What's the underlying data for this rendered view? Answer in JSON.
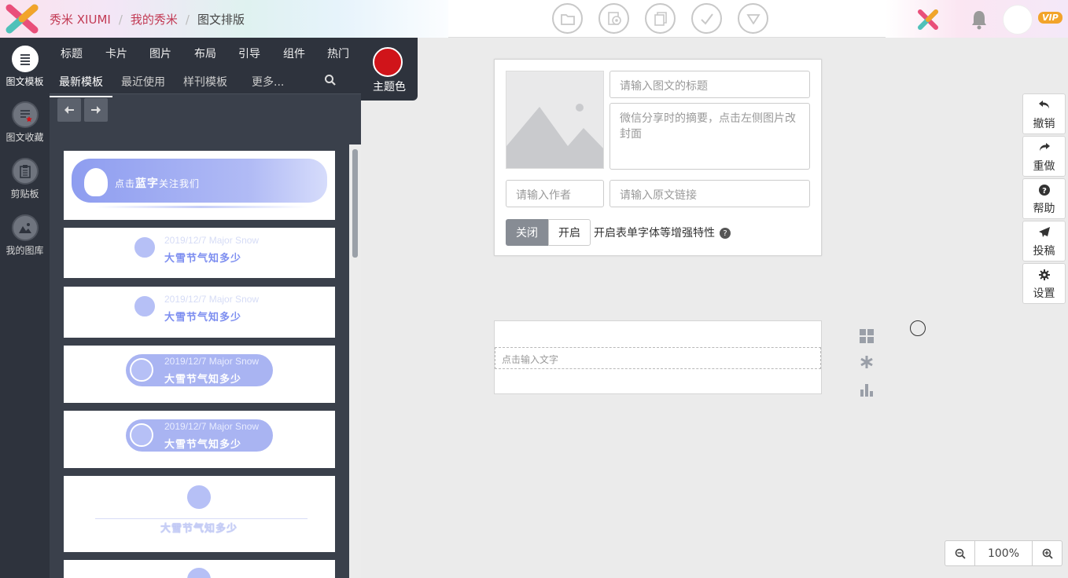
{
  "header": {
    "breadcrumb": [
      "秀米 XIUMI",
      "我的秀米",
      "图文排版"
    ],
    "vip_badge": "VIP",
    "toolbar_icons": [
      "folder-icon",
      "preview-icon",
      "copy-icon",
      "check-icon",
      "dropdown-icon"
    ]
  },
  "sidebar": {
    "items": [
      {
        "label": "图文模板",
        "icon": "list-icon",
        "active": true
      },
      {
        "label": "图文收藏",
        "icon": "favorite-icon",
        "active": false
      },
      {
        "label": "剪贴板",
        "icon": "clipboard-icon",
        "active": false
      },
      {
        "label": "我的图库",
        "icon": "image-library-icon",
        "active": false
      }
    ]
  },
  "template_panel": {
    "category_tabs": [
      "标题",
      "卡片",
      "图片",
      "布局",
      "引导",
      "组件",
      "热门"
    ],
    "sub_tabs": [
      "最新模板",
      "最近使用",
      "样刊模板",
      "更多..."
    ],
    "active_sub_tab": "最新模板",
    "theme_label": "主题色",
    "theme_color": "#d0141a",
    "templates": [
      {
        "text": "点击蓝字关注我们",
        "text_prefix": "点击",
        "text_highlight": "蓝字",
        "text_suffix": "关注我们"
      },
      {
        "date": "2019/12/7 Major Snow",
        "title": "大雪节气知多少"
      },
      {
        "date": "2019/12/7 Major Snow",
        "title": "大雪节气知多少"
      },
      {
        "date": "2019/12/7 Major Snow",
        "title": "大雪节气知多少"
      },
      {
        "date": "2019/12/7 Major Snow",
        "title": "大雪节气知多少"
      },
      {
        "title": "大雪节气知多少"
      }
    ]
  },
  "article_card": {
    "title_placeholder": "请输入图文的标题",
    "summary_placeholder": "微信分享时的摘要，点击左侧图片改封面",
    "author_placeholder": "请输入作者",
    "source_placeholder": "请输入原文链接",
    "toggle_off": "关闭",
    "toggle_on": "开启",
    "toggle_label": "开启表单字体等增强特性"
  },
  "editor": {
    "placeholder": "点击输入文字"
  },
  "right_tools": [
    {
      "label": "撤销",
      "icon": "undo-icon"
    },
    {
      "label": "重做",
      "icon": "redo-icon"
    },
    {
      "label": "帮助",
      "icon": "help-icon"
    },
    {
      "label": "投稿",
      "icon": "send-icon"
    },
    {
      "label": "设置",
      "icon": "gear-icon"
    }
  ],
  "zoom": {
    "value": "100%"
  }
}
